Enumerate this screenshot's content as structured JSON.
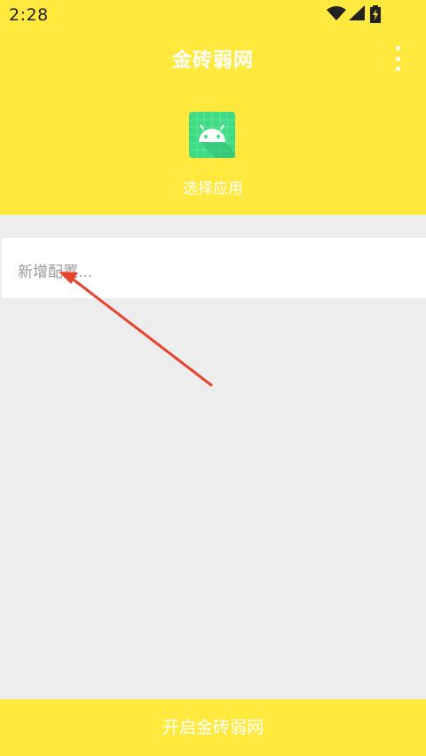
{
  "status_bar": {
    "time": "2:28",
    "icons": [
      "wifi-icon",
      "signal-icon",
      "battery-icon"
    ]
  },
  "toolbar": {
    "title": "金砖弱网",
    "menu_icon": "more-vert-icon"
  },
  "app_picker": {
    "icon": "android-icon",
    "label": "选择应用"
  },
  "config_list": {
    "add_item_label": "新增配置..."
  },
  "footer": {
    "start_button_label": "开启金砖弱网"
  },
  "annotation": {
    "arrow_icon": "red-arrow-icon",
    "color": "#e8432f"
  },
  "colors": {
    "accent": "#ffe93f",
    "background": "#ededed",
    "app_icon": "#3ddc84"
  }
}
